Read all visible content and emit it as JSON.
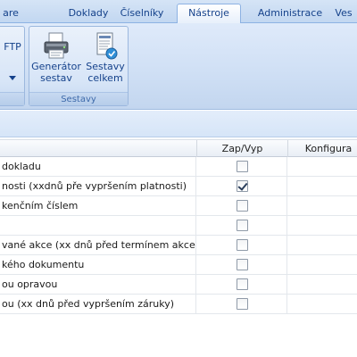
{
  "tabs": [
    {
      "label": "are",
      "active": false
    },
    {
      "label": "Doklady",
      "active": false
    },
    {
      "label": "Číselníky",
      "active": false
    },
    {
      "label": "Nástroje",
      "active": true
    },
    {
      "label": "Administrace",
      "active": false
    },
    {
      "label": "Ves",
      "active": false
    }
  ],
  "ribbon": {
    "left_group": {
      "ftp_label": "FTP"
    },
    "sestavy_group": {
      "caption": "Sestavy",
      "buttons": [
        {
          "line1": "Generátor",
          "line2": "sestav",
          "icon": "printer-icon"
        },
        {
          "line1": "Sestavy",
          "line2": "celkem",
          "icon": "report-list-icon"
        }
      ]
    }
  },
  "grid": {
    "columns": [
      "",
      "Zap/Vyp",
      "Konfigura"
    ],
    "rows": [
      {
        "name": "dokladu",
        "checked": false
      },
      {
        "name": "nosti (xxdnů pře vypršením platnosti)",
        "checked": true
      },
      {
        "name": "kenčním číslem",
        "checked": false
      },
      {
        "name": "",
        "checked": false
      },
      {
        "name": "vané akce (xx dnů před termínem akce)",
        "checked": false
      },
      {
        "name": "kého dokumentu",
        "checked": false
      },
      {
        "name": "ou opravou",
        "checked": false
      },
      {
        "name": "ou (xx dnů před vypršením záruky)",
        "checked": false
      }
    ]
  },
  "colors": {
    "tab_text": "#15428b",
    "ribbon_bg": "#d0e0f5",
    "group_caption": "#3e6aaa"
  }
}
